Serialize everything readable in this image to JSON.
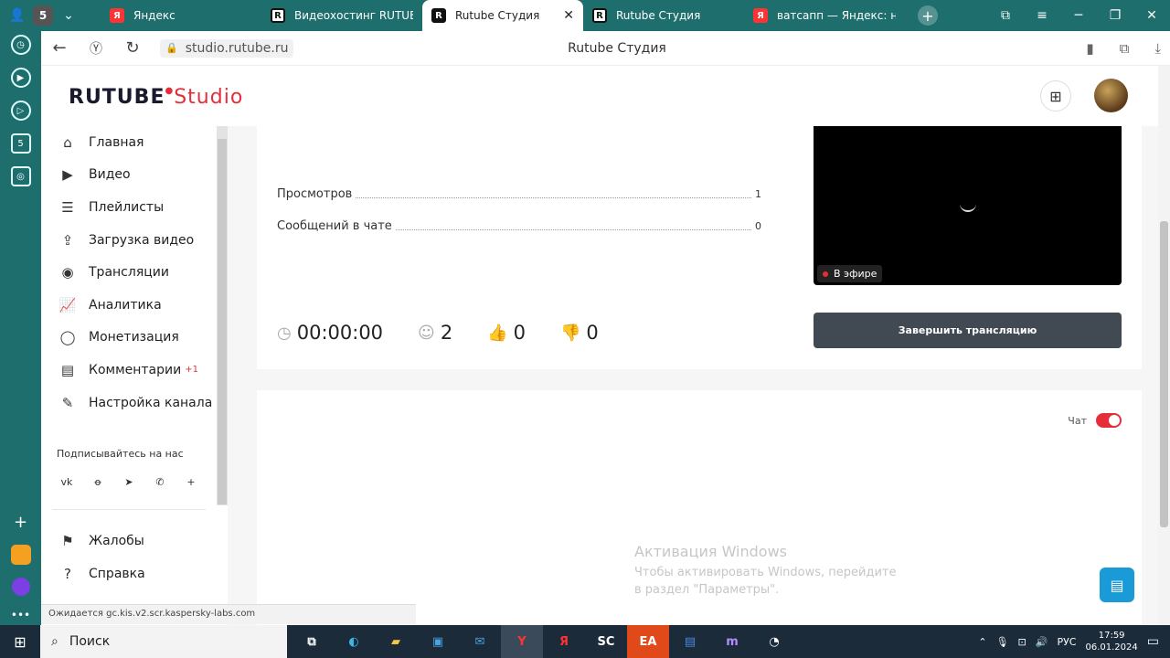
{
  "browser": {
    "tabs": [
      {
        "label": "Яндекс",
        "favicon": "Я",
        "active": false
      },
      {
        "label": "Видеохостинг RUTUBE. С",
        "favicon": "R",
        "active": false
      },
      {
        "label": "Rutube Студия",
        "favicon": "R",
        "active": true
      },
      {
        "label": "Rutube Студия",
        "favicon": "R",
        "active": false
      },
      {
        "label": "ватсапп — Яндекс: наш",
        "favicon": "Я",
        "active": false
      }
    ],
    "profile_badge": "5",
    "url": "studio.rutube.ru",
    "page_title": "Rutube Студия",
    "status_text": "Ожидается gc.kis.v2.scr.kaspersky-labs.com"
  },
  "studio": {
    "logo_main": "RUTUBE",
    "logo_accent": "Studio",
    "nav": [
      {
        "label": "Главная",
        "icon": "home-icon",
        "glyph": "⌂"
      },
      {
        "label": "Видео",
        "icon": "video-icon",
        "glyph": "▶"
      },
      {
        "label": "Плейлисты",
        "icon": "playlist-icon",
        "glyph": "☰"
      },
      {
        "label": "Загрузка видео",
        "icon": "upload-icon",
        "glyph": "⇪"
      },
      {
        "label": "Трансляции",
        "icon": "broadcast-icon",
        "glyph": "◉"
      },
      {
        "label": "Аналитика",
        "icon": "analytics-icon",
        "glyph": "📈"
      },
      {
        "label": "Монетизация",
        "icon": "monetization-icon",
        "glyph": "◯"
      },
      {
        "label": "Комментарии",
        "icon": "comments-icon",
        "glyph": "▤",
        "badge": "+1"
      },
      {
        "label": "Настройка канала",
        "icon": "wand-icon",
        "glyph": "✎"
      }
    ],
    "subscribe_label": "Подписывайтесь на нас",
    "social": [
      "vk-icon",
      "ok-icon",
      "telegram-icon",
      "viber-icon",
      "plus-icon"
    ],
    "nav_bottom": [
      {
        "label": "Жалобы",
        "icon": "complaint-icon",
        "glyph": "⚑"
      },
      {
        "label": "Справка",
        "icon": "help-icon",
        "glyph": "?"
      }
    ]
  },
  "stream": {
    "stats": [
      {
        "label": "Просмотров",
        "value": "1"
      },
      {
        "label": "Сообщений в чате",
        "value": "0"
      }
    ],
    "timer": "00:00:00",
    "viewers": "2",
    "likes": "0",
    "dislikes": "0",
    "live_label": "В эфире",
    "end_button": "Завершить трансляцию",
    "chat_label": "Чат",
    "chat_enabled": true
  },
  "watermark": {
    "title": "Активация Windows",
    "text": "Чтобы активировать Windows, перейдите в раздел \"Параметры\"."
  },
  "taskbar": {
    "search_label": "Поиск",
    "lang": "РУС",
    "time": "17:59",
    "date": "06.01.2024"
  },
  "colors": {
    "accent": "#e62e3b",
    "browser_bg": "#1e6e6e",
    "button_dark": "#414a52",
    "taskbar": "#1c2b3a"
  }
}
